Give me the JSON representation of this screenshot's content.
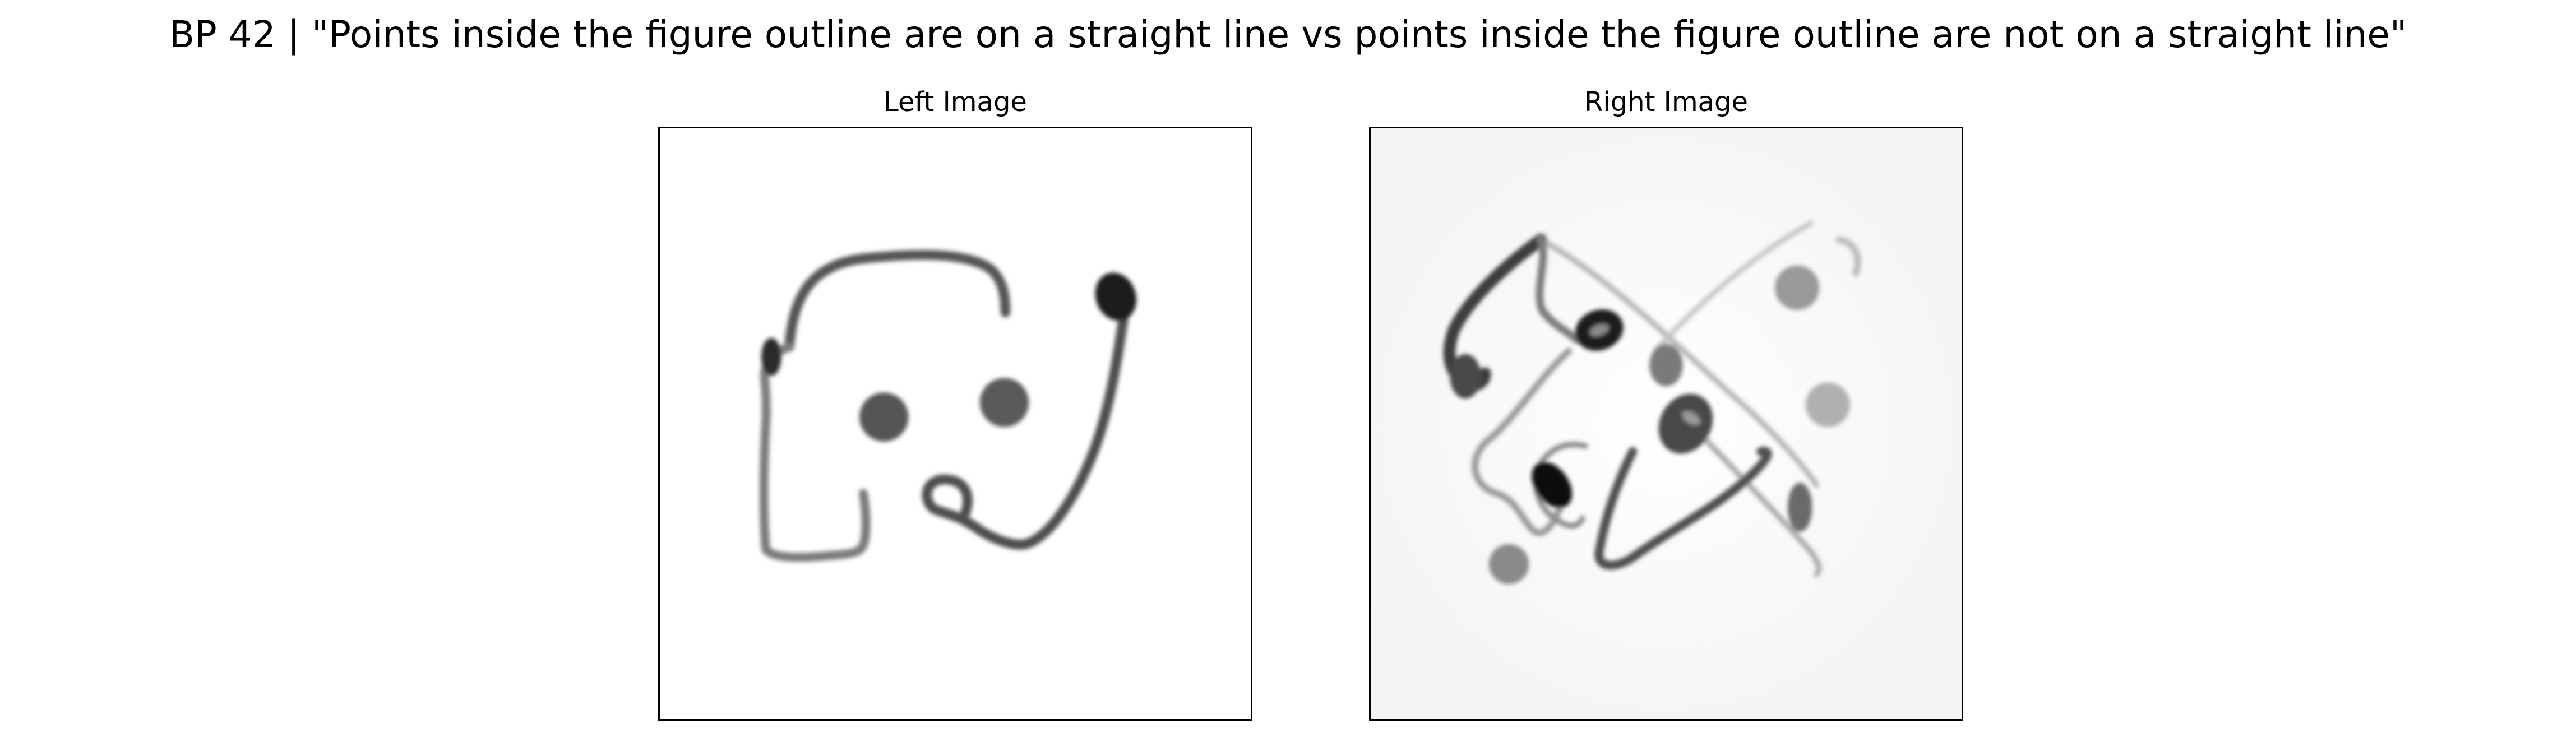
{
  "figure": {
    "title": "BP 42 | \"Points inside the figure outline are on a straight line vs points inside the figure outline are not on a straight line\""
  },
  "panels": {
    "left": {
      "title": "Left Image"
    },
    "right": {
      "title": "Right Image"
    }
  },
  "colors": {
    "background": "#ffffff",
    "ink_dark": "#1a1a1a",
    "ink_mid": "#555555",
    "ink_light": "#9a9a9a",
    "frame": "#000000"
  }
}
